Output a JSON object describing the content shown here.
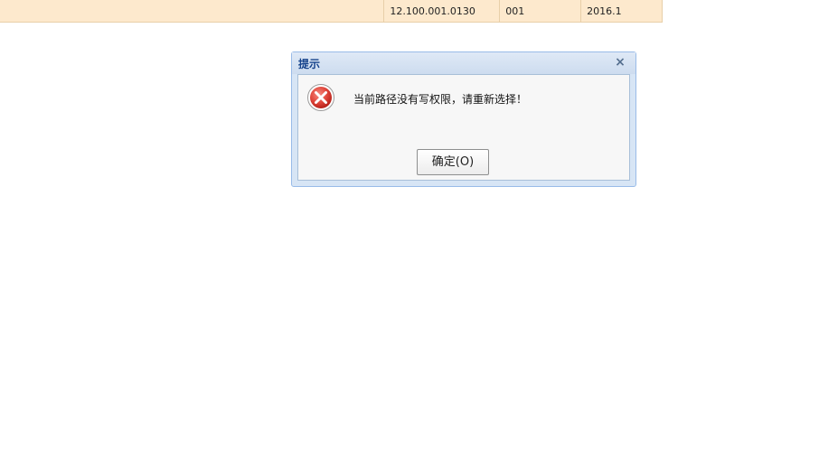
{
  "table_row": {
    "cells": [
      "",
      "12.100.001.0130",
      "001",
      "2016.1"
    ]
  },
  "dialog": {
    "title": "提示",
    "close_symbol": "×",
    "icon": "error-icon",
    "message": "当前路径没有写权限，请重新选择！",
    "ok_label": "确定(O)"
  },
  "colors": {
    "row_background": "#fde9cd",
    "dialog_title": "#15428b",
    "dialog_frame": "#d7e5f5",
    "error_red": "#d9312b"
  }
}
